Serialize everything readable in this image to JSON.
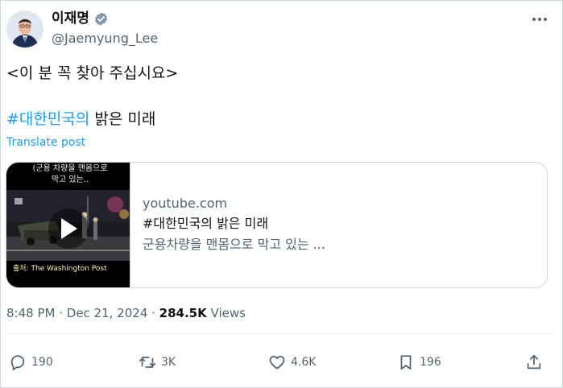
{
  "author": {
    "display_name": "이재명",
    "handle": "@Jaemyung_Lee",
    "verified": true,
    "avatar_icon": "profile-photo"
  },
  "tweet": {
    "line1": "<이 분 꼭 찾아 주십시요>",
    "hashtag": "#대한민국의",
    "line2_rest": " 밝은 미래",
    "translate_label": "Translate post"
  },
  "card": {
    "thumbnail_caption_top_1": "(군용 차량을 맨몸으로",
    "thumbnail_caption_top_2": "막고 있는..",
    "thumbnail_caption_bottom": "출처: The Washington Post",
    "domain": "youtube.com",
    "title": "#대한민국의 밝은 미래",
    "description": "군용차량을 맨몸으로 막고 있는 ..."
  },
  "meta": {
    "time": "8:48 PM",
    "sep1": " · ",
    "date": "Dec 21, 2024",
    "sep2": " · ",
    "views_count": "284.5K",
    "views_label": " Views"
  },
  "actions": {
    "replies": "190",
    "reposts": "3K",
    "likes": "4.6K",
    "bookmarks": "196"
  },
  "colors": {
    "accent": "#1d9bf0",
    "muted": "#536471",
    "text": "#0f1419",
    "border": "#cfd9de"
  }
}
